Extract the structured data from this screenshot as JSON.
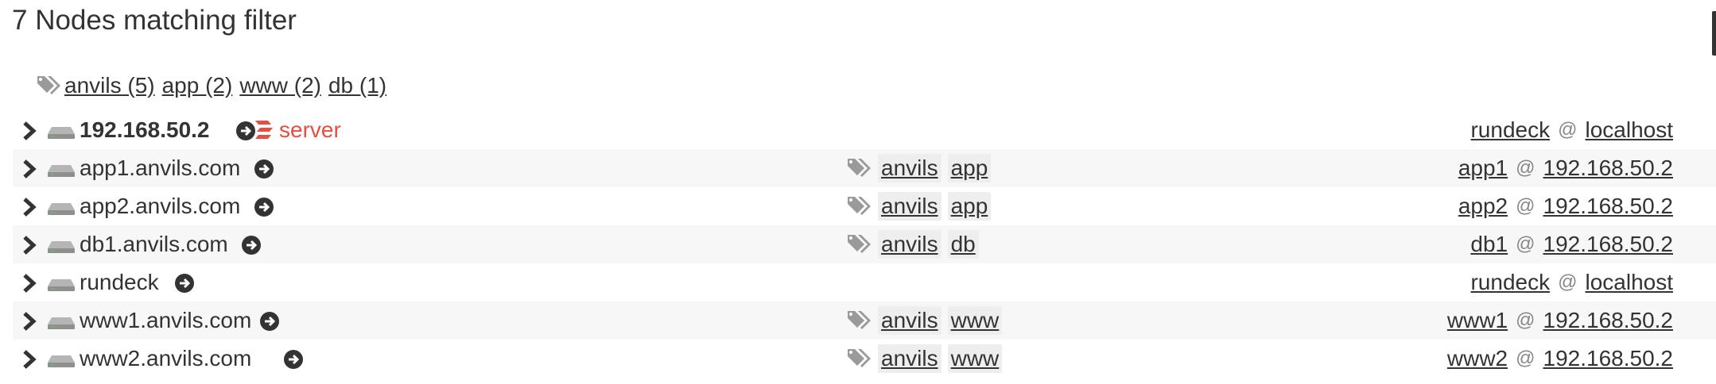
{
  "header": {
    "title": "7 Nodes matching filter"
  },
  "tag_summary": [
    {
      "label": "anvils (5)"
    },
    {
      "label": "app (2)"
    },
    {
      "label": "www (2)"
    },
    {
      "label": "db (1)"
    }
  ],
  "nodes": [
    {
      "name": "192.168.50.2",
      "bold": true,
      "badge": "server",
      "tags": [],
      "user": "rundeck",
      "at": "@",
      "host": "localhost"
    },
    {
      "name": "app1.anvils.com",
      "bold": false,
      "badge": "",
      "tags": [
        "anvils",
        "app"
      ],
      "user": "app1",
      "at": "@",
      "host": "192.168.50.2"
    },
    {
      "name": "app2.anvils.com",
      "bold": false,
      "badge": "",
      "tags": [
        "anvils",
        "app"
      ],
      "user": "app2",
      "at": "@",
      "host": "192.168.50.2"
    },
    {
      "name": "db1.anvils.com",
      "bold": false,
      "badge": "",
      "tags": [
        "anvils",
        "db"
      ],
      "user": "db1",
      "at": "@",
      "host": "192.168.50.2"
    },
    {
      "name": "rundeck",
      "bold": false,
      "badge": "",
      "tags": [],
      "user": "rundeck",
      "at": "@",
      "host": "localhost"
    },
    {
      "name": "www1.anvils.com",
      "bold": false,
      "badge": "",
      "tags": [
        "anvils",
        "www"
      ],
      "user": "www1",
      "at": "@",
      "host": "192.168.50.2"
    },
    {
      "name": "www2.anvils.com",
      "bold": false,
      "badge": "",
      "tags": [
        "anvils",
        "www"
      ],
      "user": "www2",
      "at": "@",
      "host": "192.168.50.2"
    }
  ],
  "icons": {
    "row_expand": "chevron-right-icon",
    "node": "hard-drive-icon",
    "go": "arrow-circle-right-icon",
    "tags": "tags-icon",
    "server": "rundeck-server-icon"
  },
  "colors": {
    "server_badge": "#e84d3d",
    "row_stripe": "#f7f7f7",
    "tag_bg": "#eeeeee"
  }
}
